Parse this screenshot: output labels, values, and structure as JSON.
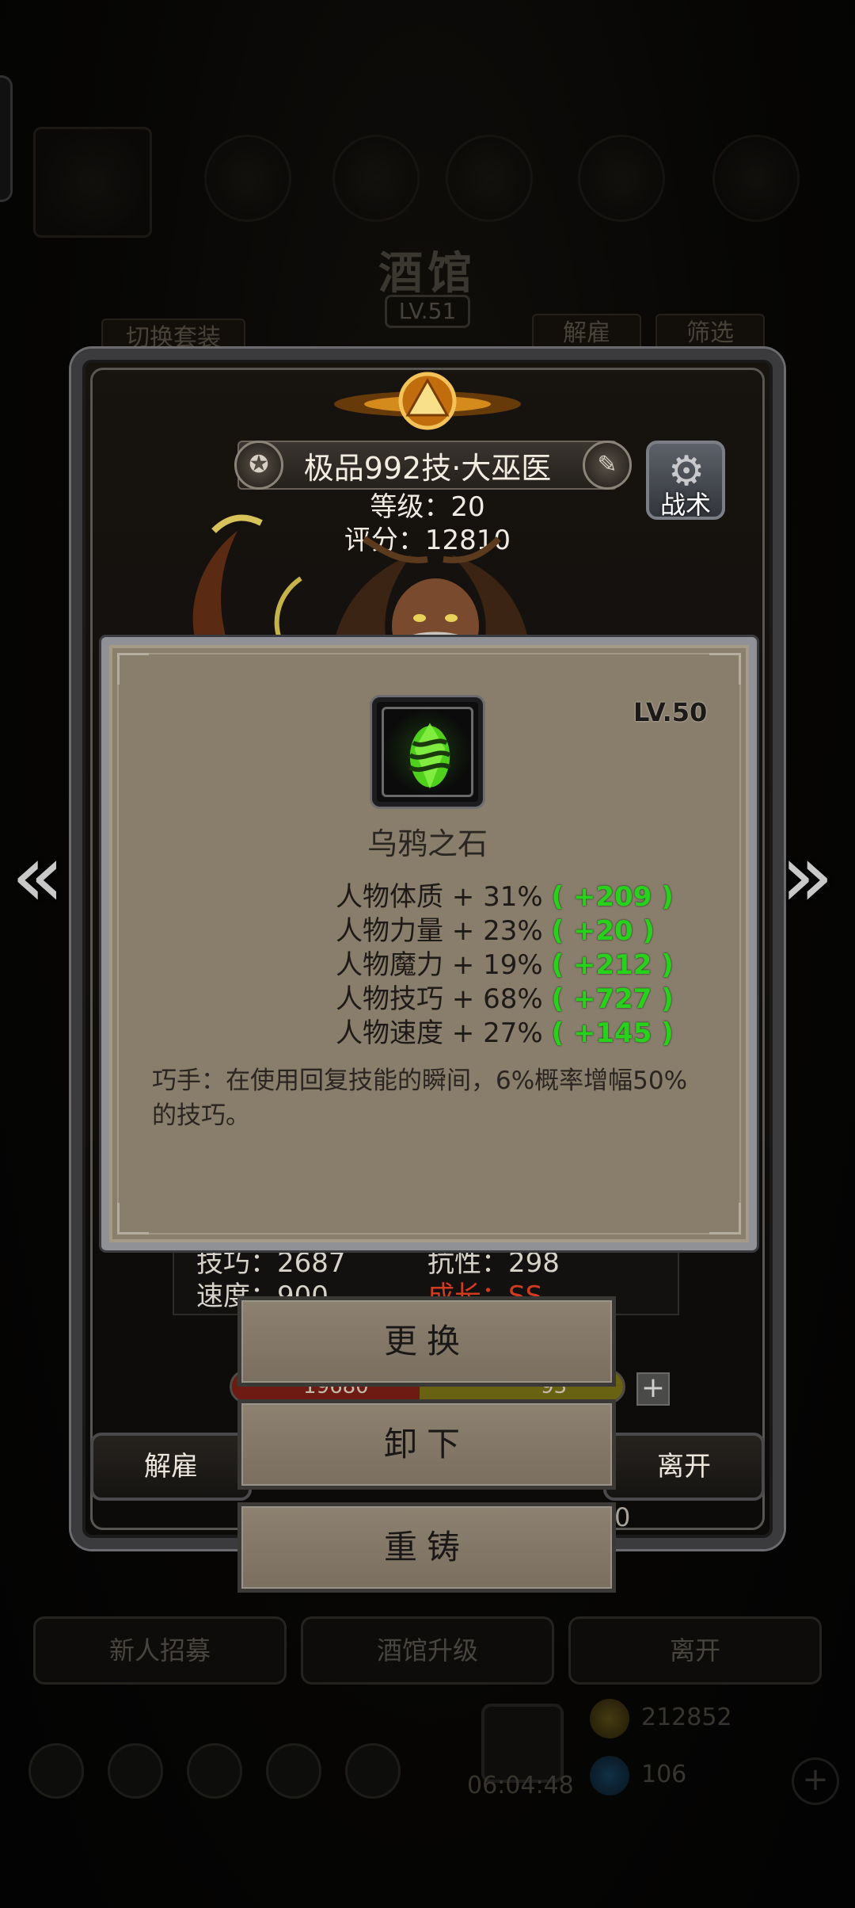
{
  "background": {
    "title": "酒馆",
    "level": "LV.51",
    "switch_outfit": "切换套装",
    "dismiss": "解雇",
    "filter": "筛选",
    "bottom_buttons": [
      "新人招募",
      "酒馆升级",
      "离开"
    ],
    "timer": "06:04:48",
    "gold": "212852",
    "gems": "106"
  },
  "hero": {
    "name": "极品992技·大巫医",
    "level_line": "等级：20",
    "score_line": "评分：12810",
    "tactic_label": "战术",
    "stats": {
      "skill": "技巧：2687",
      "resist": "抗性：298",
      "speed": "速度：900",
      "growth": "成长：SS"
    },
    "hp_value": "19680",
    "exp_value": "93",
    "dismiss_button": "解雇",
    "leave_button": "离开",
    "partial_value": "0"
  },
  "item": {
    "level": "LV.50",
    "name": "乌鸦之石",
    "attributes": [
      {
        "text": "人物体质 + 31%",
        "bonus": "+209"
      },
      {
        "text": "人物力量 + 23%",
        "bonus": "+20"
      },
      {
        "text": "人物魔力 + 19%",
        "bonus": "+212"
      },
      {
        "text": "人物技巧 + 68%",
        "bonus": "+727"
      },
      {
        "text": "人物速度 + 27%",
        "bonus": "+145"
      }
    ],
    "description": "巧手：在使用回复技能的瞬间，6%概率增幅50%的技巧。",
    "bonus_color": "#27d11c"
  },
  "actions": {
    "replace": "更换",
    "unequip": "卸下",
    "reforge": "重铸"
  }
}
